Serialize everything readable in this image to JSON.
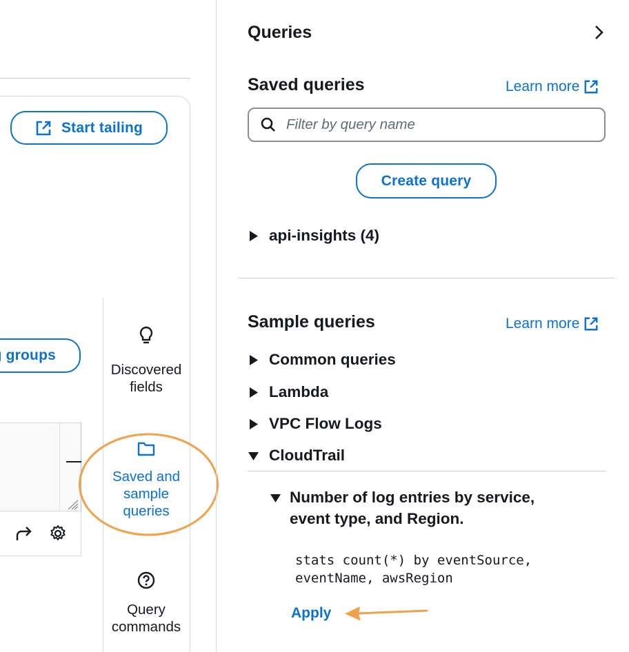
{
  "editor": {
    "start_tailing_label": "Start tailing",
    "log_groups_label": "g groups"
  },
  "rail": {
    "discovered_fields": "Discovered fields",
    "saved_and_sample": "Saved and sample queries",
    "query_commands": "Query commands"
  },
  "panel": {
    "title": "Queries",
    "saved": {
      "heading": "Saved queries",
      "learn_more": "Learn more",
      "filter_placeholder": "Filter by query name",
      "create_query": "Create query",
      "folders": [
        {
          "label": "api-insights (4)",
          "expanded": false
        }
      ]
    },
    "sample": {
      "heading": "Sample queries",
      "learn_more": "Learn more",
      "categories": [
        {
          "label": "Common queries",
          "expanded": false
        },
        {
          "label": "Lambda",
          "expanded": false
        },
        {
          "label": "VPC Flow Logs",
          "expanded": false
        },
        {
          "label": "CloudTrail",
          "expanded": true
        }
      ],
      "cloudtrail_query": {
        "label": "Number of log entries by service, event type, and Region.",
        "expanded": true,
        "code_line_1": "stats count(*) by eventSource,",
        "code_line_2": "eventName, awsRegion",
        "apply_label": "Apply"
      }
    }
  },
  "colors": {
    "accent": "#0972d3",
    "annotation": "#f0a14a",
    "text": "#16191f",
    "border": "#d5dbdb"
  },
  "icons": [
    "external-link-icon",
    "search-icon",
    "lightbulb-icon",
    "folder-icon",
    "help-circle-icon",
    "redo-icon",
    "gear-icon",
    "chevron-right-icon",
    "caret-right-icon",
    "caret-down-icon"
  ]
}
